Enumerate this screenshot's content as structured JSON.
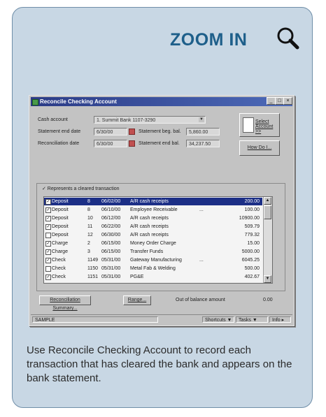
{
  "header": {
    "title": "ZOOM IN",
    "icon": "magnifier-icon"
  },
  "window": {
    "title": "Reconcile Checking Account",
    "controls": [
      "_",
      "□",
      "×"
    ],
    "cash_account_label": "Cash account",
    "cash_account_value": "1. Summit Bank 1107-3290",
    "statement_end_date_label": "Statement end date",
    "statement_end_date_value": "6/30/00",
    "reconciliation_date_label": "Reconciliation date",
    "reconciliation_date_value": "6/30/00",
    "statement_beg_bal_label": "Statement beg. bal.",
    "statement_beg_bal_value": "5,860.00",
    "statement_end_bal_label": "Statement end bal.",
    "statement_end_bal_value": "34,237.50",
    "select_account_label": "Select Account >>",
    "how_do_i_label": "How Do I...",
    "legend_text": "✓ Represents a cleared transaction",
    "transactions": [
      {
        "checked": true,
        "type": "Deposit",
        "num": "8",
        "date": "06/02/00",
        "desc": "A/R cash receipts",
        "extra": "",
        "amount": "200.00",
        "selected": true
      },
      {
        "checked": true,
        "type": "Deposit",
        "num": "8",
        "date": "06/10/00",
        "desc": "Employee Receivable",
        "extra": "...",
        "amount": "100.00",
        "selected": false
      },
      {
        "checked": true,
        "type": "Deposit",
        "num": "10",
        "date": "06/12/00",
        "desc": "A/R cash receipts",
        "extra": "",
        "amount": "10900.00",
        "selected": false
      },
      {
        "checked": true,
        "type": "Deposit",
        "num": "11",
        "date": "06/22/00",
        "desc": "A/R cash receipts",
        "extra": "",
        "amount": "509.79",
        "selected": false
      },
      {
        "checked": false,
        "type": "Deposit",
        "num": "12",
        "date": "06/30/00",
        "desc": "A/R cash receipts",
        "extra": "",
        "amount": "779.32",
        "selected": false
      },
      {
        "checked": true,
        "type": "Charge",
        "num": "2",
        "date": "06/15/00",
        "desc": "Money Order Charge",
        "extra": "",
        "amount": "15.00",
        "selected": false
      },
      {
        "checked": true,
        "type": "Charge",
        "num": "3",
        "date": "06/15/00",
        "desc": "Transfer Funds",
        "extra": "",
        "amount": "5000.00",
        "selected": false
      },
      {
        "checked": true,
        "type": "Check",
        "num": "1149",
        "date": "05/31/00",
        "desc": "Gateway Manufacturing",
        "extra": "...",
        "amount": "6045.25",
        "selected": false
      },
      {
        "checked": false,
        "type": "Check",
        "num": "1150",
        "date": "05/31/00",
        "desc": "Metal Fab & Welding",
        "extra": "",
        "amount": "500.00",
        "selected": false
      },
      {
        "checked": true,
        "type": "Check",
        "num": "1151",
        "date": "05/31/00",
        "desc": "PG&E",
        "extra": "",
        "amount": "402.67",
        "selected": false
      }
    ],
    "reconciliation_summary_label": "Reconciliation Summary...",
    "range_label": "Range...",
    "out_of_balance_label": "Out of balance amount",
    "out_of_balance_value": "0.00",
    "status_company": "SAMPLE",
    "status_shortcuts": "Shortcuts",
    "status_tasks": "Tasks",
    "status_info": "Info"
  },
  "caption": "Use Reconcile Checking Account to record each transaction that has cleared the bank and appears on the bank statement."
}
